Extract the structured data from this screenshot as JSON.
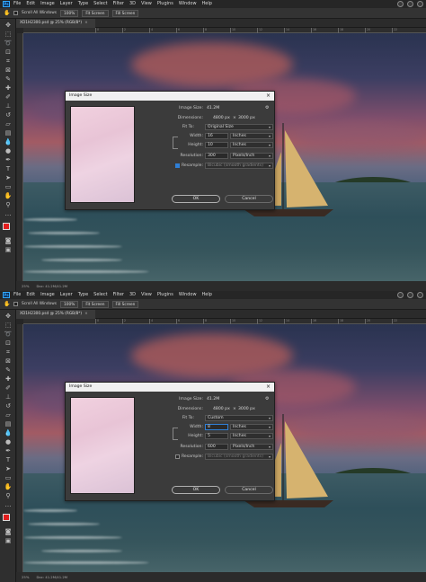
{
  "app": {
    "logo": "Ps",
    "menu": [
      "File",
      "Edit",
      "Image",
      "Layer",
      "Type",
      "Select",
      "Filter",
      "3D",
      "View",
      "Plugins",
      "Window",
      "Help"
    ],
    "options": {
      "scroll_all": "Scroll All Windows",
      "zoom": "100%",
      "fit": "Fit Screen",
      "fill": "Fill Screen"
    },
    "doc_tab": "XD1H2300.psd @ 25% (RGB/8*)",
    "close_x": "×",
    "status_zoom": "25%",
    "status_doc": "Doc: 41.2M/41.2M",
    "ruler_marks": [
      "0",
      "2",
      "4",
      "6",
      "8",
      "10",
      "12",
      "14",
      "16",
      "18",
      "20",
      "22",
      "24",
      "26",
      "28",
      "30"
    ]
  },
  "dialog_top": {
    "title": "Image Size",
    "image_size_label": "Image Size:",
    "image_size_value": "41.2M",
    "dimensions_label": "Dimensions:",
    "dimensions_w": "4800 px",
    "dimensions_x": "×",
    "dimensions_h": "3000 px",
    "fit_to_label": "Fit To:",
    "fit_to_value": "Original Size",
    "width_label": "Width:",
    "width_value": "16",
    "width_unit": "Inches",
    "height_label": "Height:",
    "height_value": "10",
    "height_unit": "Inches",
    "resolution_label": "Resolution:",
    "resolution_value": "300",
    "resolution_unit": "Pixels/Inch",
    "resample_label": "Resample:",
    "resample_value": "Bicubic (smooth gradients)",
    "resample_checked": true,
    "ok_label": "OK",
    "cancel_label": "Cancel"
  },
  "dialog_bottom": {
    "title": "Image Size",
    "image_size_label": "Image Size:",
    "image_size_value": "41.2M",
    "dimensions_label": "Dimensions:",
    "dimensions_w": "4800 px",
    "dimensions_x": "×",
    "dimensions_h": "3000 px",
    "fit_to_label": "Fit To:",
    "fit_to_value": "Custom",
    "width_label": "Width:",
    "width_value": "8",
    "width_unit": "Inches",
    "height_label": "Height:",
    "height_value": "5",
    "height_unit": "Inches",
    "resolution_label": "Resolution:",
    "resolution_value": "600",
    "resolution_unit": "Pixels/Inch",
    "resample_label": "Resample:",
    "resample_value": "Bicubic (smooth gradients)",
    "resample_checked": false,
    "ok_label": "OK",
    "cancel_label": "Cancel"
  },
  "colors": {
    "accent": "#2f7fd6",
    "foreground_swatch": "#e21d1d",
    "background_swatch": "#111111",
    "ps_blue": "#31a8ff"
  },
  "icons": [
    "hand-icon",
    "gear-icon",
    "close-icon",
    "chevron-down-icon",
    "link-icon",
    "move-icon",
    "marquee-icon",
    "lasso-icon",
    "crop-icon",
    "eyedropper-icon",
    "brush-icon",
    "stamp-icon",
    "eraser-icon",
    "gradient-icon",
    "pen-icon",
    "type-icon",
    "path-select-icon",
    "shape-icon",
    "zoom-icon"
  ]
}
